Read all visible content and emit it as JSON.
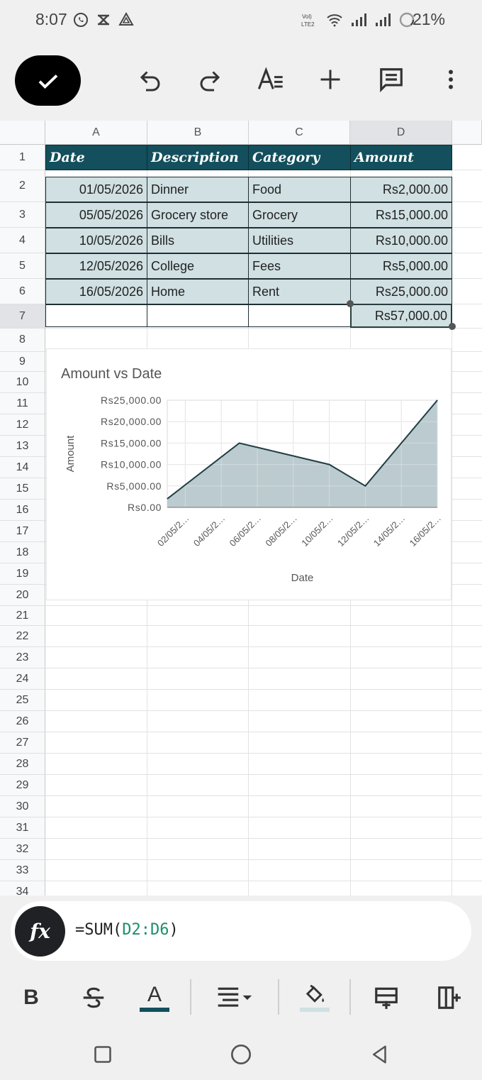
{
  "status_bar": {
    "time": "8:07",
    "battery": "21%",
    "left_icons": [
      "whatsapp-icon",
      "capcut-icon",
      "drive-icon"
    ],
    "right_icons": [
      "volte-icon",
      "wifi-icon",
      "signal-icon",
      "signal-icon",
      "battery-saver-icon"
    ]
  },
  "toolbar": {
    "icons": [
      "check-icon",
      "undo-icon",
      "redo-icon",
      "text-format-icon",
      "add-icon",
      "comment-icon",
      "more-icon"
    ]
  },
  "sheet": {
    "columns": [
      "A",
      "B",
      "C",
      "D"
    ],
    "selected_column": "D",
    "rows": [
      "1",
      "2",
      "3",
      "4",
      "5",
      "6",
      "7",
      "8",
      "9",
      "10",
      "11",
      "12",
      "13",
      "14",
      "15",
      "16",
      "17",
      "18",
      "19",
      "20",
      "21",
      "22",
      "23",
      "24",
      "25",
      "26",
      "27",
      "28",
      "29",
      "30",
      "31",
      "32",
      "33",
      "34"
    ],
    "selected_row": "7",
    "header": [
      "Date",
      "Description",
      "Category",
      "Amount"
    ],
    "data": [
      [
        "01/05/2026",
        "Dinner",
        "Food",
        "Rs2,000.00"
      ],
      [
        "05/05/2026",
        "Grocery store",
        "Grocery",
        "Rs15,000.00"
      ],
      [
        "10/05/2026",
        "Bills",
        "Utilities",
        "Rs10,000.00"
      ],
      [
        "12/05/2026",
        "College",
        "Fees",
        "Rs5,000.00"
      ],
      [
        "16/05/2026",
        "Home",
        "Rent",
        "Rs25,000.00"
      ]
    ],
    "total": "Rs57,000.00"
  },
  "chart_data": {
    "type": "area",
    "title": "Amount  vs Date",
    "xlabel": "Date",
    "ylabel": "Amount",
    "x_tick_labels": [
      "02/05/2…",
      "04/05/2…",
      "06/05/2…",
      "08/05/2…",
      "10/05/2…",
      "12/05/2…",
      "14/05/2…",
      "16/05/2…"
    ],
    "y_tick_labels": [
      "Rs25,000.00",
      "Rs20,000.00",
      "Rs15,000.00",
      "Rs10,000.00",
      "Rs5,000.00",
      "Rs0.00"
    ],
    "x": [
      "01/05/2026",
      "05/05/2026",
      "10/05/2026",
      "12/05/2026",
      "16/05/2026"
    ],
    "values": [
      2000,
      15000,
      10000,
      5000,
      25000
    ],
    "ylim": [
      0,
      25000
    ],
    "xlim": [
      "01/05/2026",
      "16/05/2026"
    ],
    "grid": true,
    "fill_color": "#b8c8cc",
    "line_color": "#1f3d44"
  },
  "formula_bar": {
    "prefix": "=SUM(",
    "range": "D2:D6",
    "suffix": ")",
    "fx_label": "fx"
  },
  "format_bar": {
    "icons": [
      "bold-icon",
      "strikethrough-icon",
      "text-color-icon",
      "align-icon",
      "fill-color-icon",
      "insert-row-icon",
      "insert-column-icon"
    ],
    "bold_label": "B",
    "text_color_label": "A"
  },
  "nav_bar": {
    "icons": [
      "recents-icon",
      "home-icon",
      "back-icon"
    ]
  },
  "colors": {
    "header_fill": "#134f5c",
    "row_fill": "#d0e0e3",
    "formula_ref": "#1e8e6e"
  }
}
